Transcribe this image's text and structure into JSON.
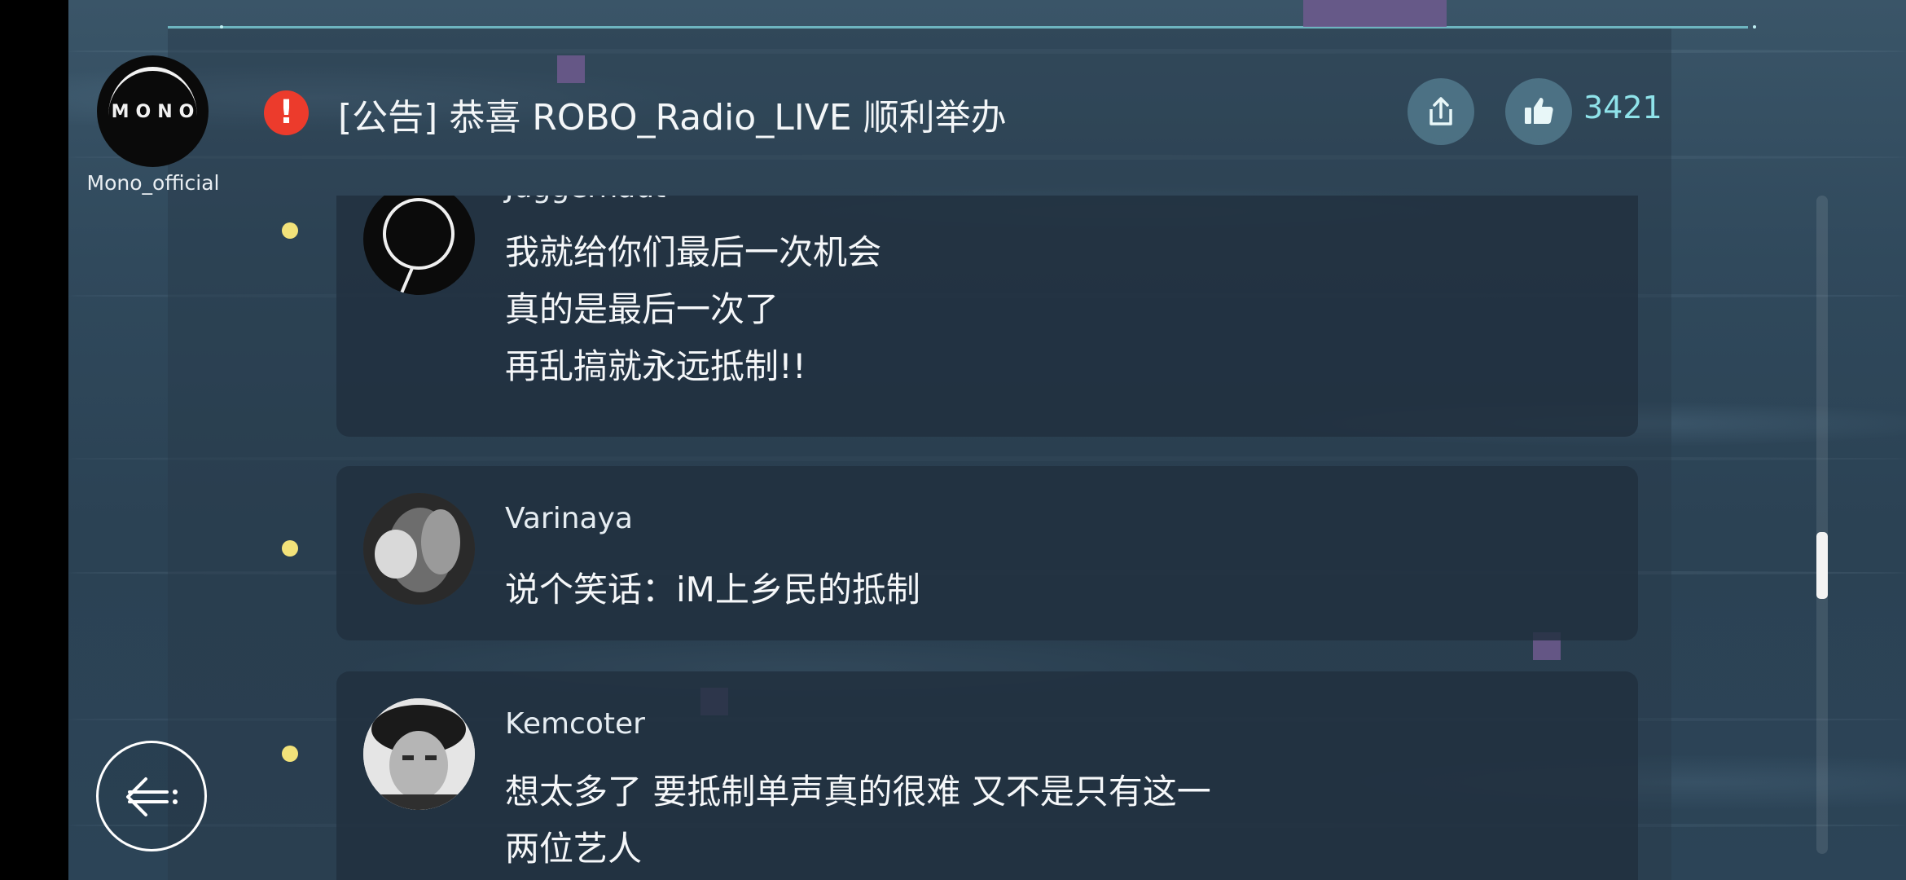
{
  "channel": {
    "name": "Mono_official",
    "logo_text": "MONO"
  },
  "header": {
    "alert_symbol": "!",
    "title": "[公告] 恭喜 ROBO_Radio_LIVE 顺利举办",
    "like_count": "3421",
    "accent_color": "#8fe3ea",
    "alert_color": "#ec3b2c"
  },
  "icons": {
    "share": "share-icon",
    "like": "thumbs-up-icon",
    "back": "back-arrow-icon",
    "bullet": "bullet-dot"
  },
  "comments": [
    {
      "user": "Juggernaut",
      "lines": [
        "我就给你们最后一次机会",
        "真的是最后一次了",
        "再乱搞就永远抵制!!"
      ]
    },
    {
      "user": "Varinaya",
      "lines": [
        "说个笑话：iM上乡民的抵制"
      ]
    },
    {
      "user": "Kemcoter",
      "lines": [
        "想太多了 要抵制单声真的很难 又不是只有这一",
        "两位艺人"
      ]
    }
  ]
}
